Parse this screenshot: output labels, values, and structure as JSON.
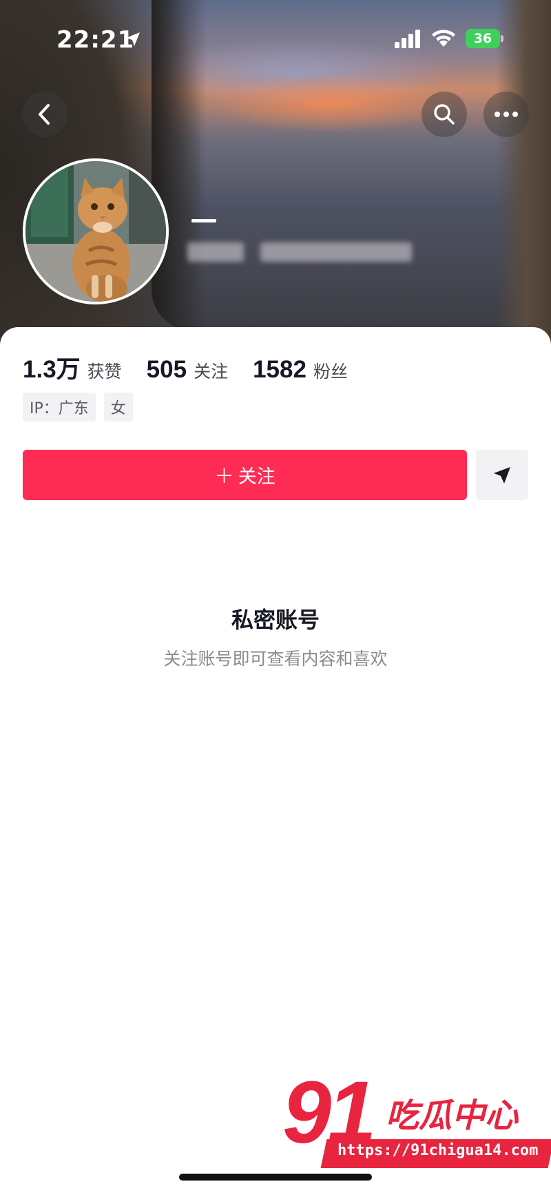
{
  "status_bar": {
    "time": "22:21",
    "battery": "36"
  },
  "profile": {
    "name": "—"
  },
  "stats": [
    {
      "value": "1.3万",
      "label": "获赞"
    },
    {
      "value": "505",
      "label": "关注"
    },
    {
      "value": "1582",
      "label": "粉丝"
    }
  ],
  "tags": [
    "IP：广东",
    "女"
  ],
  "follow_button": {
    "plus": "+",
    "label": "关注"
  },
  "private_notice": {
    "title": "私密账号",
    "subtitle": "关注账号即可查看内容和喜欢"
  },
  "watermark": {
    "number": "91",
    "text": "吃瓜中心",
    "url": "https://91chigua14.com"
  },
  "colors": {
    "accent": "#fe2c55",
    "battery": "#3dd15c",
    "watermark": "#e8243f"
  }
}
